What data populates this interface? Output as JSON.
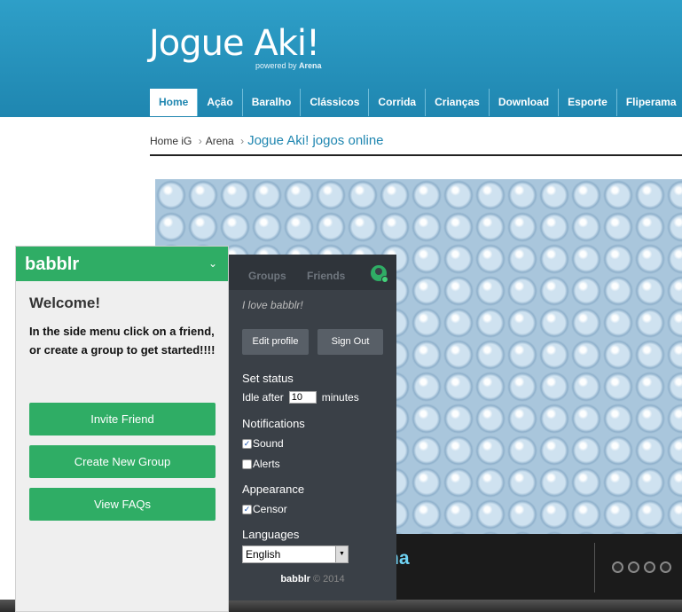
{
  "site": {
    "logo": "Jogue Aki!",
    "powered_by": "powered by",
    "powered_brand": "Arena"
  },
  "nav": [
    "Home",
    "Ação",
    "Baralho",
    "Clássicos",
    "Corrida",
    "Crianças",
    "Download",
    "Esporte",
    "Fliperama"
  ],
  "breadcrumb": {
    "home": "Home iG",
    "sep1": "›",
    "section": "Arena",
    "sep2": "›",
    "current": "Jogue Aki! jogos online"
  },
  "game": {
    "title_fragment": "ha",
    "sub_fragment": "s"
  },
  "babblr": {
    "brand": "babblr",
    "chevron": "⌄",
    "welcome": "Welcome!",
    "intro": "In the side menu click on a friend, or create a group to get started!!!!",
    "buttons": [
      "Invite Friend",
      "Create New Group",
      "View FAQs"
    ]
  },
  "settings": {
    "tabs": [
      "Groups",
      "Friends"
    ],
    "motto": "I love babblr!",
    "edit_profile": "Edit profile",
    "sign_out": "Sign Out",
    "set_status": "Set status",
    "idle_prefix": "Idle after",
    "idle_value": "10",
    "idle_suffix": "minutes",
    "notifications": "Notifications",
    "sound": "Sound",
    "sound_checked": true,
    "alerts": "Alerts",
    "alerts_checked": false,
    "appearance": "Appearance",
    "censor": "Censor",
    "censor_checked": true,
    "languages": "Languages",
    "language_selected": "English",
    "footer_brand": "babblr",
    "footer_copy": "© 2014"
  },
  "colors": {
    "header_blue": "#1f86b0",
    "babblr_green": "#2fad65",
    "settings_bg": "#3a4047"
  }
}
